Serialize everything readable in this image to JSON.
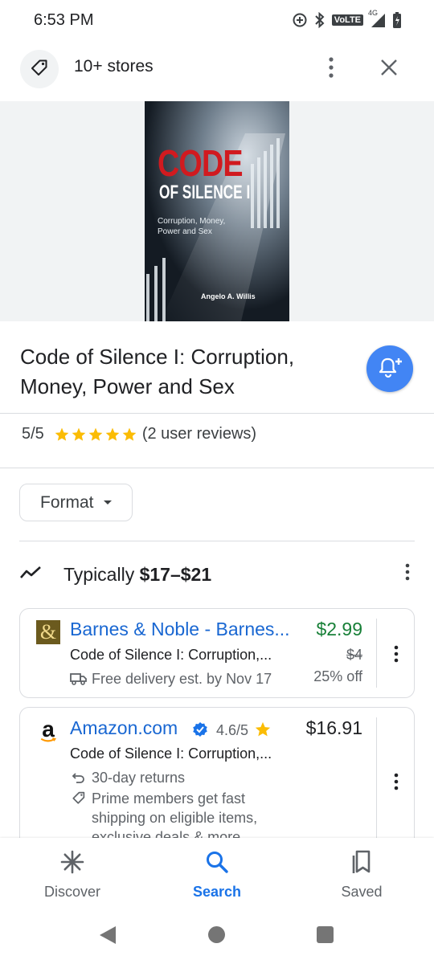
{
  "status_bar": {
    "time": "6:53 PM",
    "network_label": "VoLTE",
    "network_type": "4G"
  },
  "top_bar": {
    "stores_label": "10+ stores"
  },
  "book_cover": {
    "title_line1": "CODE",
    "title_line2": "OF SILENCE I",
    "subtitle_line1": "Corruption, Money,",
    "subtitle_line2": "Power and Sex",
    "author": "Angelo A. Willis"
  },
  "product": {
    "title": "Code of Silence I: Corruption, Money, Power and Sex",
    "rating_value": "5/5",
    "stars": 5,
    "reviews": "(2 user reviews)"
  },
  "filters": {
    "format_label": "Format"
  },
  "price_summary": {
    "prefix": "Typically ",
    "range": "$17–$21"
  },
  "stores": [
    {
      "name": "Barnes & Noble - Barnes...",
      "item": "Code of Silence I: Corruption,...",
      "delivery": "Free delivery est. by Nov 17",
      "price": "$2.99",
      "original_price": "$4",
      "discount": "25% off"
    },
    {
      "name": "Amazon.com",
      "seller_rating": "4.6/5",
      "item": "Code of Silence I: Corruption,...",
      "returns": "30-day returns",
      "promo_line1": "Prime members get fast",
      "promo_line2": "shipping on eligible items,",
      "promo_line3": "exclusive deals & more",
      "price": "$16.91"
    }
  ],
  "bottom_nav": {
    "discover": "Discover",
    "search": "Search",
    "saved": "Saved",
    "active": "Search"
  },
  "colors": {
    "accent_blue": "#1a73e8",
    "fab_blue": "#4285f4",
    "star_yellow": "#fbbc04",
    "sale_green": "#188038",
    "store_link": "#1967d2"
  }
}
